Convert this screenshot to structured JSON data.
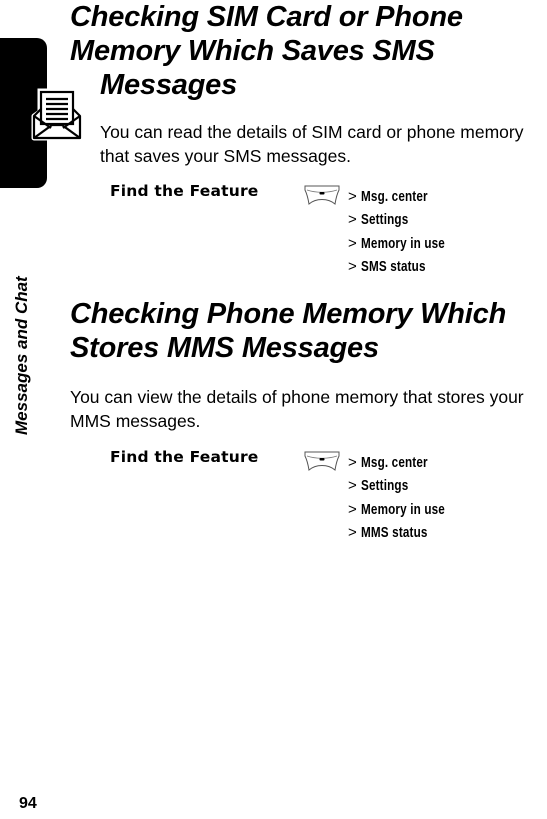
{
  "sidebar": {
    "section_label": "Messages and Chat",
    "icon": "message-envelope-icon"
  },
  "sections": [
    {
      "title_line1": "Checking SIM Card or Phone Memory Which Saves SMS",
      "title_line2": "Messages",
      "body": "You can read the details of SIM card or phone memory that saves your SMS messages.",
      "find_feature_label": "Find the Feature",
      "menu_key_icon": "menu-key-icon",
      "path": [
        "Msg. center",
        "Settings",
        "Memory in use",
        "SMS status"
      ]
    },
    {
      "title": "Checking Phone Memory Which Stores MMS Messages",
      "body": "You can view the details of phone memory that stores your MMS messages.",
      "find_feature_label": "Find the Feature",
      "menu_key_icon": "menu-key-icon",
      "path": [
        "Msg. center",
        "Settings",
        "Memory in use",
        "MMS status"
      ]
    }
  ],
  "path_separator": ">",
  "footer": {
    "page_number": "94"
  }
}
